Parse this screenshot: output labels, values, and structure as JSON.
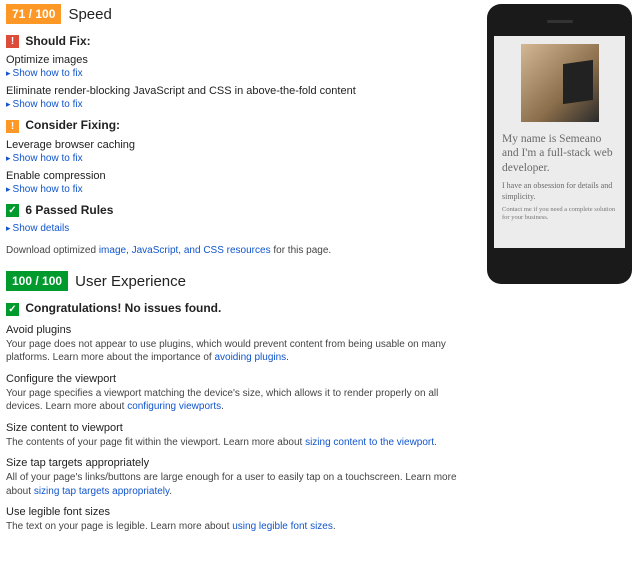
{
  "speed": {
    "score": "71 / 100",
    "label": "Speed",
    "should_fix": {
      "icon": "!",
      "title": "Should Fix:",
      "rules": [
        {
          "title": "Optimize images",
          "action": "Show how to fix"
        },
        {
          "title": "Eliminate render-blocking JavaScript and CSS in above-the-fold content",
          "action": "Show how to fix"
        }
      ]
    },
    "consider": {
      "icon": "!",
      "title": "Consider Fixing:",
      "rules": [
        {
          "title": "Leverage browser caching",
          "action": "Show how to fix"
        },
        {
          "title": "Enable compression",
          "action": "Show how to fix"
        }
      ]
    },
    "passed": {
      "icon": "✓",
      "title": "6 Passed Rules",
      "action": "Show details"
    },
    "download_prefix": "Download optimized ",
    "download_link": "image, JavaScript, and CSS resources",
    "download_suffix": " for this page."
  },
  "ux": {
    "score": "100 / 100",
    "label": "User Experience",
    "congrats": {
      "icon": "✓",
      "title": "Congratulations! No issues found."
    },
    "items": [
      {
        "title": "Avoid plugins",
        "text_a": "Your page does not appear to use plugins, which would prevent content from being usable on many platforms. Learn more about the importance of ",
        "link": "avoiding plugins",
        "text_b": "."
      },
      {
        "title": "Configure the viewport",
        "text_a": "Your page specifies a viewport matching the device's size, which allows it to render properly on all devices. Learn more about ",
        "link": "configuring viewports",
        "text_b": "."
      },
      {
        "title": "Size content to viewport",
        "text_a": "The contents of your page fit within the viewport. Learn more about ",
        "link": "sizing content to the viewport",
        "text_b": "."
      },
      {
        "title": "Size tap targets appropriately",
        "text_a": "All of your page's links/buttons are large enough for a user to easily tap on a touchscreen. Learn more about ",
        "link": "sizing tap targets appropriately",
        "text_b": "."
      },
      {
        "title": "Use legible font sizes",
        "text_a": "The text on your page is legible. Learn more about ",
        "link": "using legible font sizes",
        "text_b": "."
      }
    ]
  },
  "preview": {
    "headline": "My name is Semeano and I'm a full-stack web developer.",
    "sub": "I have an obsession for details and simplicity.",
    "contact": "Contact me if you need a complete solution for your business."
  }
}
